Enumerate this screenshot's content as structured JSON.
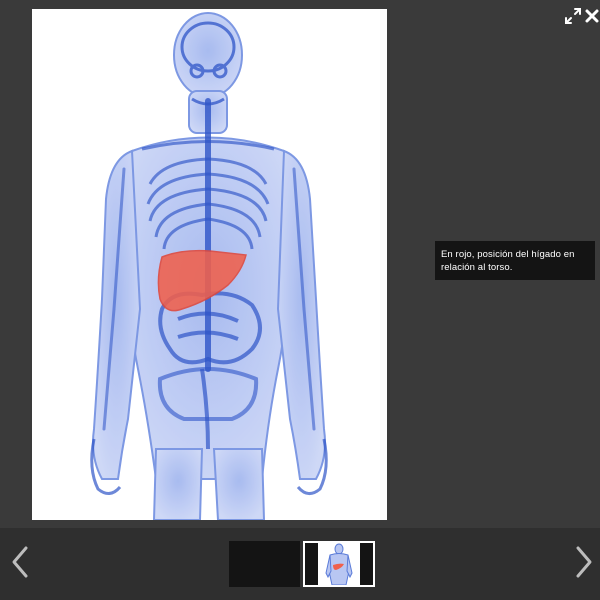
{
  "viewer": {
    "caption": "En rojo, posición del hígado en relación al torso.",
    "image_subject": "human-torso-liver-illustration",
    "colors": {
      "background": "#3a3a3a",
      "filmstrip": "#2f2f2f",
      "caption_bg": "#141414",
      "body_blue": "#2f55c8",
      "liver_red": "#f0604c"
    }
  },
  "controls": {
    "fullscreen_icon": "expand-arrows-icon",
    "close_icon": "close-x-icon",
    "prev_icon": "chevron-left-icon",
    "next_icon": "chevron-right-icon"
  },
  "filmstrip": {
    "thumbnails": [
      {
        "selected": false
      },
      {
        "selected": true
      }
    ]
  }
}
